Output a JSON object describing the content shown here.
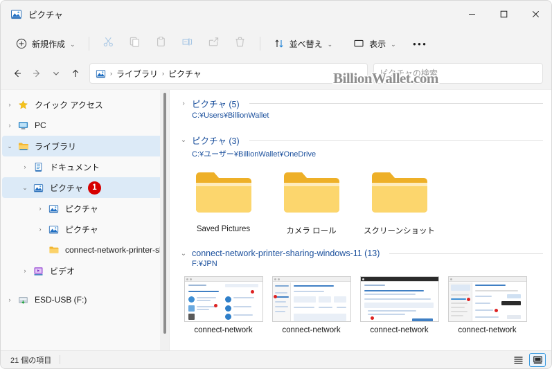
{
  "window": {
    "title": "ピクチャ",
    "title_icon": "pictures-library-icon",
    "controls": {
      "minimize": "─",
      "maximize": "□",
      "close": "✕"
    }
  },
  "toolbar": {
    "new_label": "新規作成",
    "new_icon": "plus-circle-icon",
    "cut_icon": "scissors-icon",
    "copy_icon": "copy-icon",
    "paste_icon": "clipboard-icon",
    "rename_icon": "rename-icon",
    "share_icon": "share-icon",
    "delete_icon": "trash-icon",
    "sort_label": "並べ替え",
    "sort_icon": "sort-arrows-icon",
    "view_label": "表示",
    "view_icon": "monitor-icon",
    "more_label": "•••"
  },
  "addressbar": {
    "back_icon": "arrow-left-icon",
    "forward_icon": "arrow-right-icon",
    "recent_icon": "chevron-down-icon",
    "up_icon": "arrow-up-icon",
    "path_icon": "pictures-library-icon",
    "crumbs": [
      "ライブラリ",
      "ピクチャ"
    ],
    "separator": "›"
  },
  "search": {
    "placeholder": "ピクチャの検索",
    "value": "",
    "icon": "search-icon"
  },
  "watermark": {
    "text": "BillionWallet.com"
  },
  "sidebar": {
    "items": [
      {
        "label": "クイック アクセス",
        "icon": "star-icon",
        "expander": "chevron-right",
        "indent": 0,
        "selected": false,
        "badge": null
      },
      {
        "label": "PC",
        "icon": "pc-icon",
        "expander": "chevron-right",
        "indent": 0,
        "selected": false,
        "badge": null
      },
      {
        "label": "ライブラリ",
        "icon": "folder-icon",
        "expander": "chevron-down",
        "indent": 0,
        "selected": true,
        "badge": null
      },
      {
        "label": "ドキュメント",
        "icon": "documents-library-icon",
        "expander": "chevron-right",
        "indent": 1,
        "selected": false,
        "badge": null
      },
      {
        "label": "ピクチャ",
        "icon": "pictures-library-icon",
        "expander": "chevron-down",
        "indent": 1,
        "selected": true,
        "badge": "1"
      },
      {
        "label": "ピクチャ",
        "icon": "pictures-library-icon",
        "expander": "chevron-right",
        "indent": 2,
        "selected": false,
        "badge": null
      },
      {
        "label": "ピクチャ",
        "icon": "pictures-library-icon",
        "expander": "chevron-right",
        "indent": 2,
        "selected": false,
        "badge": null
      },
      {
        "label": "connect-network-printer-shari",
        "icon": "folder-icon",
        "expander": "none",
        "indent": 3,
        "selected": false,
        "badge": null
      },
      {
        "label": "ビデオ",
        "icon": "videos-library-icon",
        "expander": "chevron-right",
        "indent": 1,
        "selected": false,
        "badge": null
      },
      {
        "label": "ESD-USB (F:)",
        "icon": "usb-drive-icon",
        "expander": "chevron-right",
        "indent": 0,
        "selected": false,
        "badge": null
      }
    ]
  },
  "content": {
    "groups": [
      {
        "title": "ピクチャ (5)",
        "path": "C:¥Users¥BillionWallet",
        "expander": "chevron-right",
        "collapsed": true,
        "items": []
      },
      {
        "title": "ピクチャ (3)",
        "path": "C:¥ユーザー¥BillionWallet¥OneDrive",
        "expander": "chevron-down",
        "collapsed": false,
        "items": [
          {
            "label": "Saved Pictures",
            "type": "folder"
          },
          {
            "label": "カメラ ロール",
            "type": "folder"
          },
          {
            "label": "スクリーンショット",
            "type": "folder"
          }
        ]
      },
      {
        "title": "connect-network-printer-sharing-windows-11 (13)",
        "path": "F:¥JPN",
        "expander": "chevron-down",
        "collapsed": false,
        "items": [
          {
            "label": "connect-network",
            "type": "image"
          },
          {
            "label": "connect-network",
            "type": "image"
          },
          {
            "label": "connect-network",
            "type": "image"
          },
          {
            "label": "connect-network",
            "type": "image"
          }
        ]
      }
    ]
  },
  "statusbar": {
    "count_text": "21 個の項目",
    "list_view_icon": "list-view-icon",
    "details_view_icon": "details-view-icon",
    "active_view": "details"
  },
  "colors": {
    "accent": "#0f6cbd",
    "link": "#1a4f9c",
    "selection": "#dceaf7",
    "badge": "#d60000",
    "folder": "#f7c94b"
  }
}
